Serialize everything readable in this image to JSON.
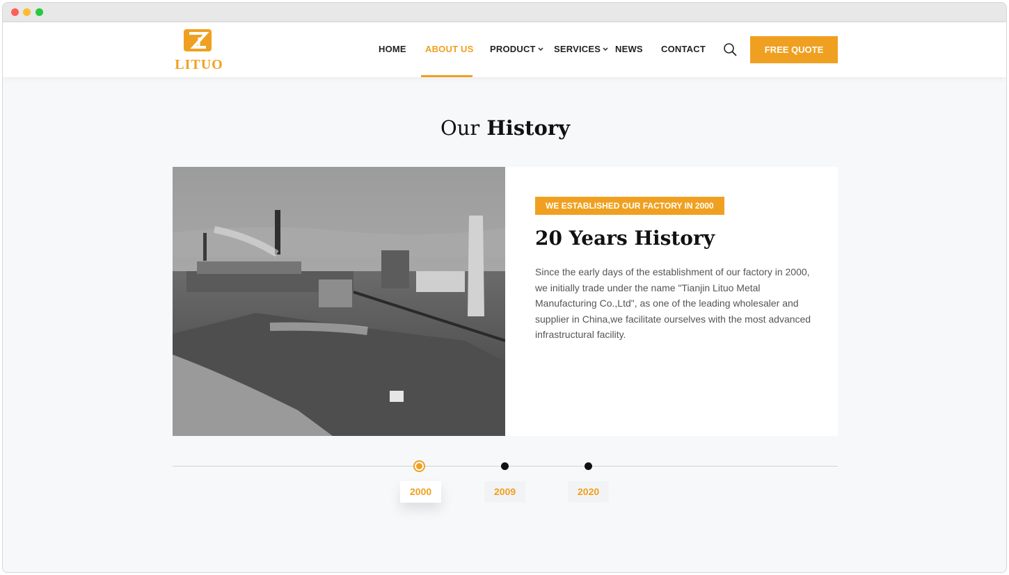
{
  "brand": {
    "name": "LITUO",
    "color": "#f0a020"
  },
  "nav": {
    "items": [
      {
        "label": "HOME",
        "active": false
      },
      {
        "label": "ABOUT US",
        "active": true
      },
      {
        "label": "PRODUCT",
        "active": false,
        "dropdown": true
      },
      {
        "label": "SERVICES",
        "active": false,
        "dropdown": true
      },
      {
        "label": "NEWS",
        "active": false
      },
      {
        "label": "CONTACT",
        "active": false
      }
    ],
    "search_icon": "search-icon",
    "quote_label": "FREE QUOTE"
  },
  "section": {
    "title_light": "Our",
    "title_bold": "History"
  },
  "history": {
    "tag": "WE ESTABLISHED OUR FACTORY IN 2000",
    "title_light": "20 Years",
    "title_bold": "History",
    "text": "Since the early days of the establishment of our factory in 2000, we initially trade under the name \"Tianjin Lituo Metal Manufacturing Co.,Ltd\", as one of the leading wholesaler and supplier in China,we facilitate ourselves with the most advanced infrastructural facility.",
    "image": "historical black-and-white photo of factory"
  },
  "timeline": {
    "years": [
      {
        "label": "2000",
        "active": true
      },
      {
        "label": "2009",
        "active": false
      },
      {
        "label": "2020",
        "active": false
      }
    ]
  }
}
